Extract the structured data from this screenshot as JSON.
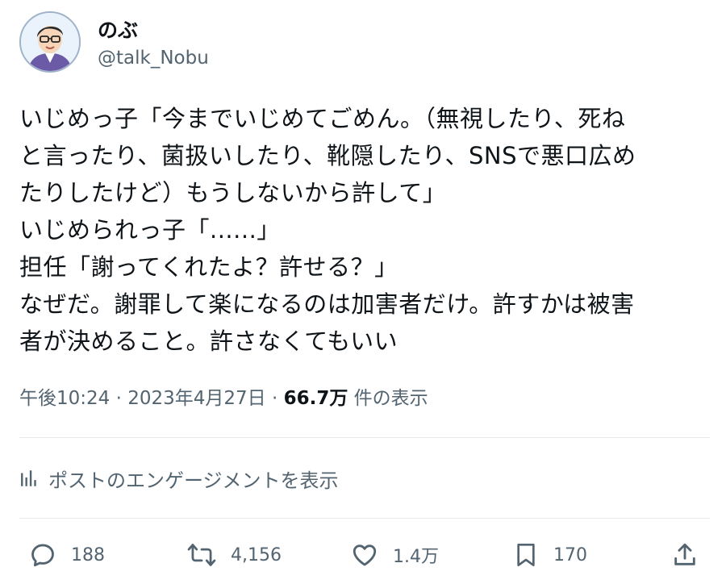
{
  "author": {
    "name": "のぶ",
    "handle": "@talk_Nobu"
  },
  "post": {
    "lines": [
      "いじめっ子「今までいじめてごめん。（無視したり、死ね",
      "と言ったり、菌扱いしたり、靴隠したり、SNSで悪口広め",
      "たりしたけど）もうしないから許して」",
      "いじめられっ子「......」",
      "担任「謝ってくれたよ？許せる？」",
      "なぜだ。謝罪して楽になるのは加害者だけ。許すかは被害",
      "者が決めること。許さなくてもいい"
    ]
  },
  "meta": {
    "time": "午後10:24",
    "sep1": " · ",
    "date": "2023年4月27日",
    "sep2": " · ",
    "views": "66.7万",
    "views_suffix": " 件の表示"
  },
  "engagement_link": "ポストのエンゲージメントを表示",
  "actions": {
    "replies": "188",
    "reposts": "4,156",
    "likes": "1.4万",
    "bookmarks": "170"
  },
  "colors": {
    "text": "#0f1419",
    "secondary": "#536471",
    "divider": "#e6e9ec"
  },
  "icons": [
    "reply-icon",
    "repost-icon",
    "like-icon",
    "bookmark-icon",
    "share-icon",
    "analytics-icon"
  ]
}
